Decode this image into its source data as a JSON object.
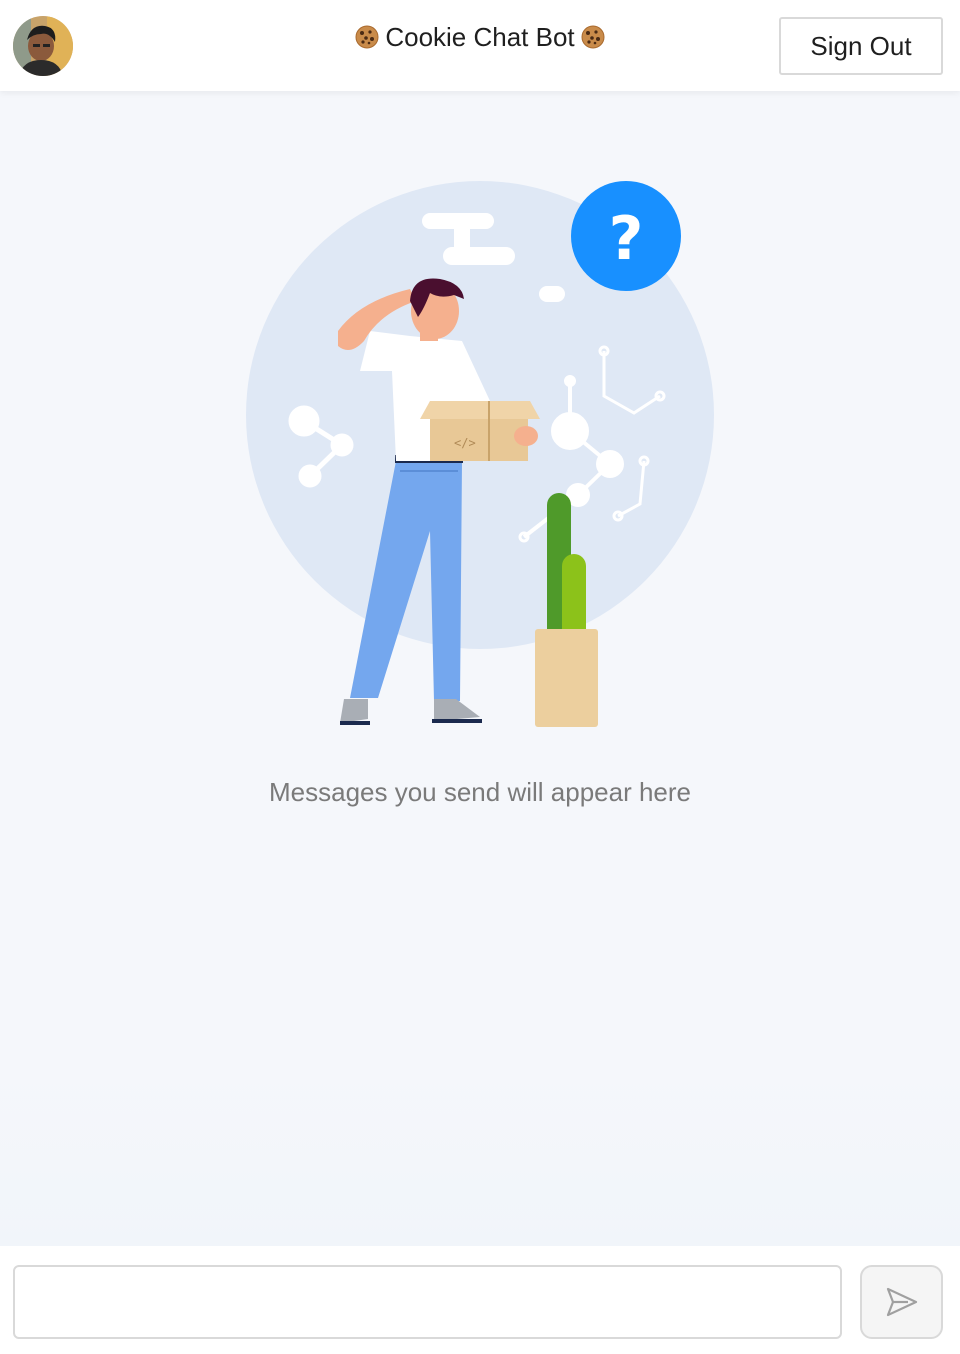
{
  "header": {
    "title": "Cookie Chat Bot",
    "sign_out_label": "Sign Out",
    "avatar_icon": "user-avatar",
    "title_icons": [
      "cookie-icon",
      "cookie-icon"
    ]
  },
  "main": {
    "empty_message": "Messages you send will appear here",
    "illustration": "confused-person-with-box-illustration"
  },
  "composer": {
    "input_value": "",
    "input_placeholder": "",
    "send_icon": "send-icon"
  },
  "colors": {
    "accent": "#1890ff",
    "background": "#f5f7fb",
    "border": "#d9d9d9",
    "muted_text": "#7a7a7a"
  }
}
